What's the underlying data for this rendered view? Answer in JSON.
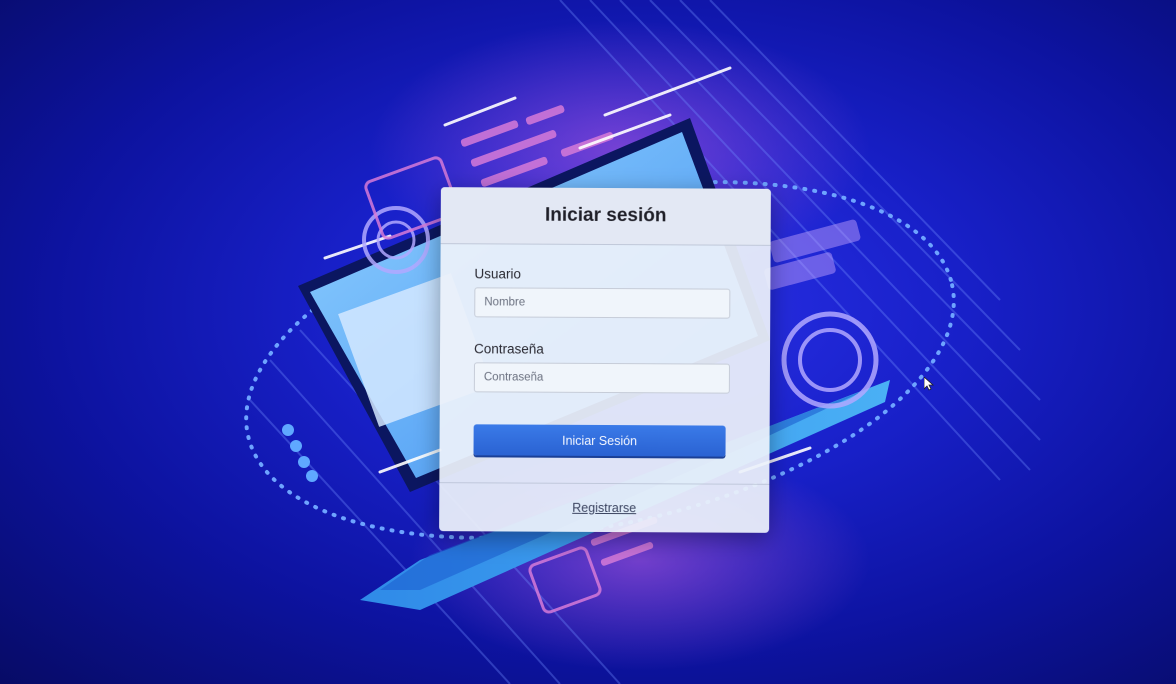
{
  "login": {
    "title": "Iniciar sesión",
    "username_label": "Usuario",
    "username_placeholder": "Nombre",
    "password_label": "Contraseña",
    "password_placeholder": "Contraseña",
    "submit_label": "Iniciar Sesión",
    "register_link": "Registrarse"
  },
  "background": {
    "illustration": "laptop-tech-illustration",
    "accent_color": "#2a30e8",
    "highlight_color": "#d77bd8"
  },
  "cursor": {
    "icon": "mouse-pointer-icon"
  }
}
